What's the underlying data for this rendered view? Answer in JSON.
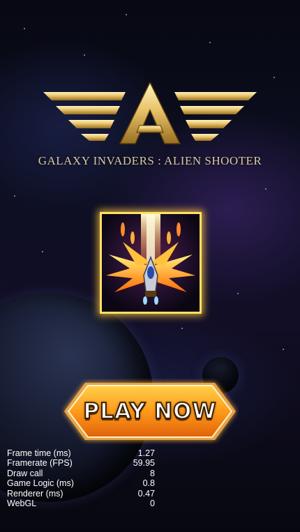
{
  "game": {
    "title": "GALAXY INVADERS : ALIEN SHOOTER",
    "logo_letter": "A",
    "play_button": "PLAY NOW"
  },
  "stats": [
    {
      "label": "Frame time (ms)",
      "value": "1.27"
    },
    {
      "label": "Framerate (FPS)",
      "value": "59.95"
    },
    {
      "label": "Draw call",
      "value": "8"
    },
    {
      "label": "Game Logic (ms)",
      "value": "0.8"
    },
    {
      "label": "Renderer (ms)",
      "value": "0.47"
    },
    {
      "label": "WebGL",
      "value": "0"
    }
  ],
  "colors": {
    "logo_gold": "#e8c46a",
    "button_orange": "#ff9a1a",
    "icon_border": "#ffe066",
    "title_text": "#d9c9a4"
  }
}
